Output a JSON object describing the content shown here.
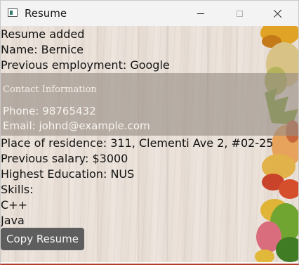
{
  "window": {
    "title": "Resume",
    "controls": [
      "minimize",
      "maximize",
      "close"
    ]
  },
  "content": {
    "status": "Resume added",
    "name_line": "Name: Bernice",
    "previous_employment_line": "Previous employment: Google",
    "contact": {
      "heading": "Contact Information",
      "phone_line": "Phone: 98765432",
      "email_line": "Email: johnd@example.com"
    },
    "residence_line": "Place of residence: 311, Clementi Ave 2, #02-25",
    "salary_line": "Previous salary: $3000",
    "education_line": "Highest Education: NUS",
    "skills_label": "Skills:",
    "skills": [
      "C++",
      "Java"
    ],
    "copy_button_label": "Copy Resume"
  },
  "colors": {
    "button_bg": "#5e5e5e",
    "contact_panel_bg": "#968c84",
    "title_bar_bg": "#f3f3f3"
  }
}
